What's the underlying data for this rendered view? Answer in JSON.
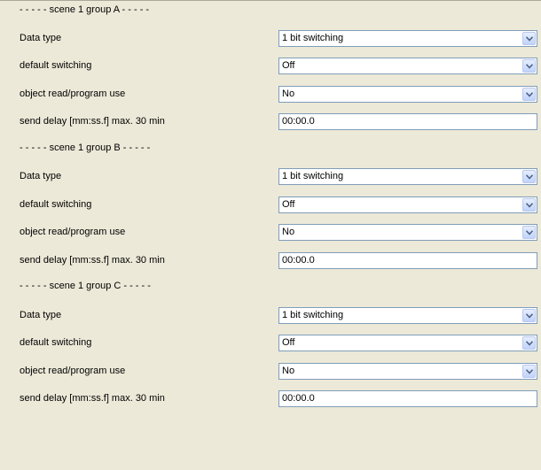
{
  "groups": [
    {
      "header": "- - - - - scene 1 group A - - - - -",
      "data_type": {
        "label": "Data type",
        "value": "1 bit switching"
      },
      "default_switching": {
        "label": "default switching",
        "value": "Off"
      },
      "object_read": {
        "label": "object read/program use",
        "value": "No"
      },
      "send_delay": {
        "label": "send delay [mm:ss.f] max. 30 min",
        "value": "00:00.0"
      }
    },
    {
      "header": "- - - - - scene 1 group B - - - - -",
      "data_type": {
        "label": "Data type",
        "value": "1 bit switching"
      },
      "default_switching": {
        "label": "default switching",
        "value": "Off"
      },
      "object_read": {
        "label": "object read/program use",
        "value": "No"
      },
      "send_delay": {
        "label": "send delay [mm:ss.f] max. 30 min",
        "value": "00:00.0"
      }
    },
    {
      "header": "- - - - - scene 1 group C - - - - -",
      "data_type": {
        "label": "Data type",
        "value": "1 bit switching"
      },
      "default_switching": {
        "label": "default switching",
        "value": "Off"
      },
      "object_read": {
        "label": "object read/program use",
        "value": "No"
      },
      "send_delay": {
        "label": "send delay [mm:ss.f] max. 30 min",
        "value": "00:00.0"
      }
    }
  ],
  "icons": {
    "dropdown": "chevron-down-icon"
  }
}
